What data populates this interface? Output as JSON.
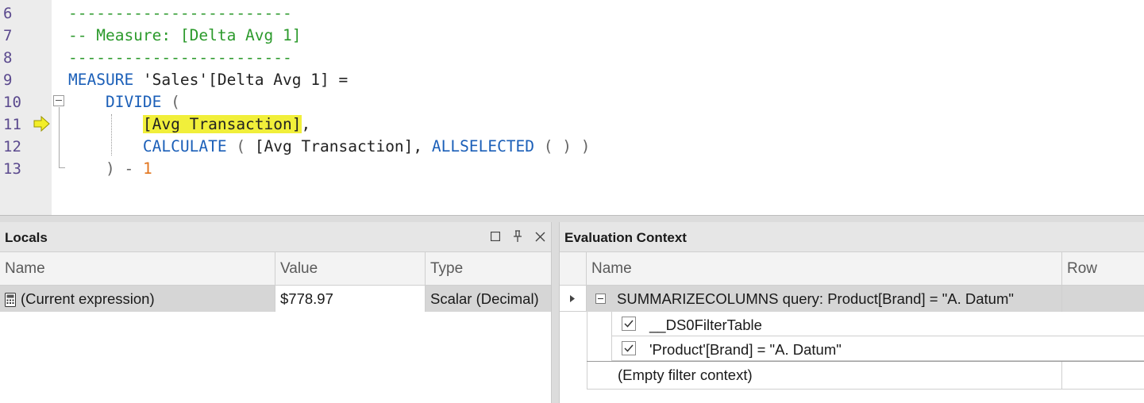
{
  "editor": {
    "line_numbers": [
      "6",
      "7",
      "8",
      "9",
      "10",
      "11",
      "12",
      "13"
    ],
    "lines": {
      "l6": "------------------------",
      "l7": "-- Measure: [Delta Avg 1]",
      "l8": "------------------------",
      "l9_kw": "MEASURE",
      "l9_rest": " 'Sales'[Delta Avg 1] =",
      "l10_kw": "DIVIDE",
      "l10_paren": " (",
      "l11_hl": "[Avg Transaction]",
      "l11_rest": ",",
      "l12_kw": "CALCULATE",
      "l12_p1": " ( ",
      "l12_ref": "[Avg Transaction], ",
      "l12_kw2": "ALLSELECTED",
      "l12_p2": " ( ) )",
      "l13_paren": ") - ",
      "l13_num": "1"
    },
    "colors": {
      "comment": "#2c9a2c",
      "keyword": "#1b5fb8",
      "number": "#e2741c",
      "highlight": "#f1ef3a"
    }
  },
  "locals": {
    "title": "Locals",
    "columns": [
      "Name",
      "Value",
      "Type"
    ],
    "rows": [
      {
        "icon": "calculator-icon",
        "name": "(Current expression)",
        "value": "$778.97",
        "type": "Scalar (Decimal)"
      }
    ]
  },
  "evaluation_context": {
    "title": "Evaluation Context",
    "columns": [
      "Name",
      "Row"
    ],
    "rows": [
      {
        "label": "SUMMARIZECOLUMNS query: Product[Brand] = \"A. Datum\"",
        "expanded": true
      },
      {
        "label": "__DS0FilterTable",
        "checked": true
      },
      {
        "label": "'Product'[Brand] = \"A. Datum\"",
        "checked": true
      },
      {
        "label": "(Empty filter context)"
      }
    ]
  }
}
